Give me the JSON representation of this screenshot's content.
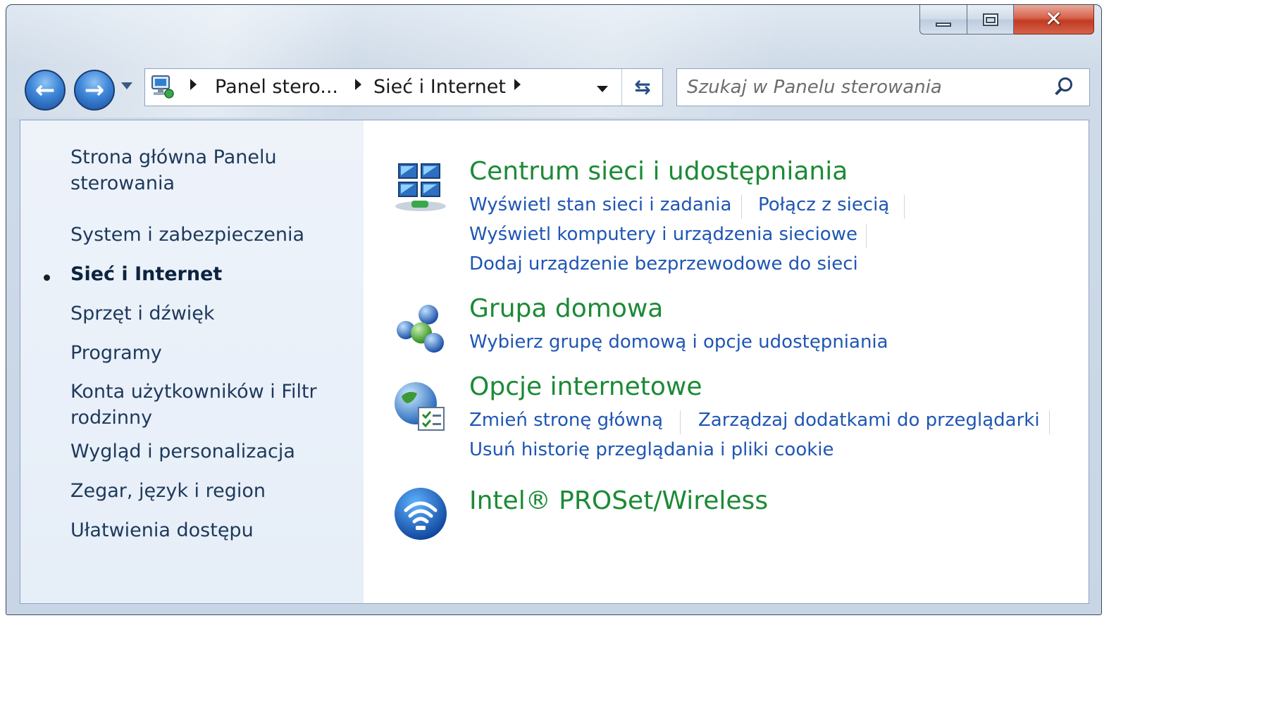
{
  "window": {
    "colors": {
      "accent_green": "#1c8a36",
      "link_blue": "#1f56b4",
      "close_red": "#c13b22"
    },
    "caption_buttons": {
      "minimize": "minimize-icon",
      "maximize": "maximize-icon",
      "close": "close-icon"
    }
  },
  "toolbar": {
    "back_icon": "arrow-left-icon",
    "forward_icon": "arrow-right-icon",
    "breadcrumbs": [
      "Panel stero...",
      "Sieć i Internet"
    ],
    "refresh_icon": "refresh-icon",
    "search_placeholder": "Szukaj w Panelu sterowania"
  },
  "sidebar": {
    "items": [
      {
        "label": "Strona główna Panelu"
      },
      {
        "label": "sterowania"
      },
      {
        "label": "System i zabezpieczenia"
      },
      {
        "label": "Sieć i Internet",
        "active": true
      },
      {
        "label": "Sprzęt i dźwięk"
      },
      {
        "label": "Programy"
      },
      {
        "label": "Konta użytkowników i Filtr"
      },
      {
        "label": "rodzinny"
      },
      {
        "label": "Wygląd i personalizacja"
      },
      {
        "label": "Zegar, język i region"
      },
      {
        "label": "Ułatwienia dostępu"
      }
    ]
  },
  "main": {
    "categories": [
      {
        "title": "Centrum sieci i udostępniania",
        "icon": "network-center-icon",
        "links": [
          "Wyświetl stan sieci i zadania",
          "Połącz z siecią",
          "Wyświetl komputery i urządzenia sieciowe",
          "Dodaj urządzenie bezprzewodowe do sieci"
        ]
      },
      {
        "title": "Grupa domowa",
        "icon": "homegroup-icon",
        "links": [
          "Wybierz grupę domową i opcje udostępniania"
        ]
      },
      {
        "title": "Opcje internetowe",
        "icon": "internet-options-icon",
        "links": [
          "Zmień stronę główną",
          "Zarządzaj dodatkami do przeglądarki",
          "Usuń historię przeglądania i pliki cookie"
        ]
      },
      {
        "title": "Intel® PROSet/Wireless",
        "icon": "wireless-icon",
        "links": []
      }
    ]
  }
}
